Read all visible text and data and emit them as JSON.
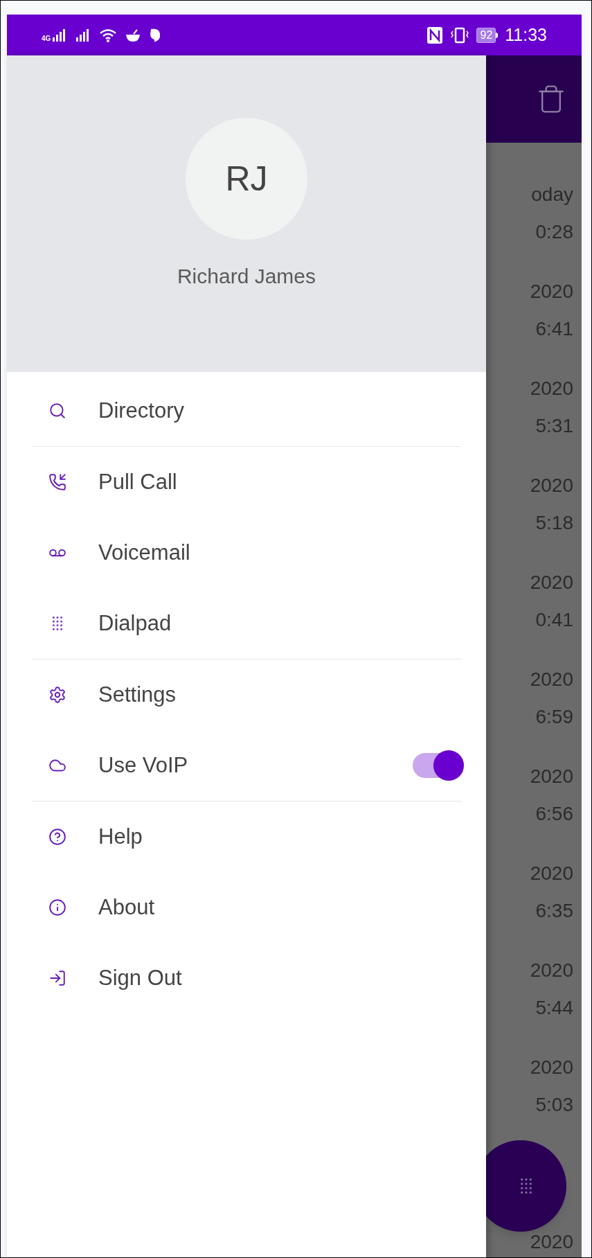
{
  "status_bar": {
    "network": "4G",
    "battery": "92",
    "time": "11:33"
  },
  "profile": {
    "initials": "RJ",
    "name": "Richard James"
  },
  "menu_sections": [
    [
      {
        "label": "Directory"
      }
    ],
    [
      {
        "label": "Pull Call"
      },
      {
        "label": "Voicemail"
      },
      {
        "label": "Dialpad"
      }
    ],
    [
      {
        "label": "Settings"
      },
      {
        "label": "Use VoIP",
        "toggle": {
          "on": true
        }
      }
    ],
    [
      {
        "label": "Help"
      },
      {
        "label": "About"
      },
      {
        "label": "Sign Out"
      }
    ]
  ],
  "background_list": [
    {
      "date": "oday",
      "time": "0:28"
    },
    {
      "date": "2020",
      "time": "6:41"
    },
    {
      "date": "2020",
      "time": "5:31"
    },
    {
      "date": "2020",
      "time": "5:18"
    },
    {
      "date": "2020",
      "time": "0:41"
    },
    {
      "date": "2020",
      "time": "6:59"
    },
    {
      "date": "2020",
      "time": "6:56"
    },
    {
      "date": "2020",
      "time": "6:35"
    },
    {
      "date": "2020",
      "time": "5:44"
    },
    {
      "date": "2020",
      "time": "5:03"
    }
  ],
  "background_last_date": "2020"
}
